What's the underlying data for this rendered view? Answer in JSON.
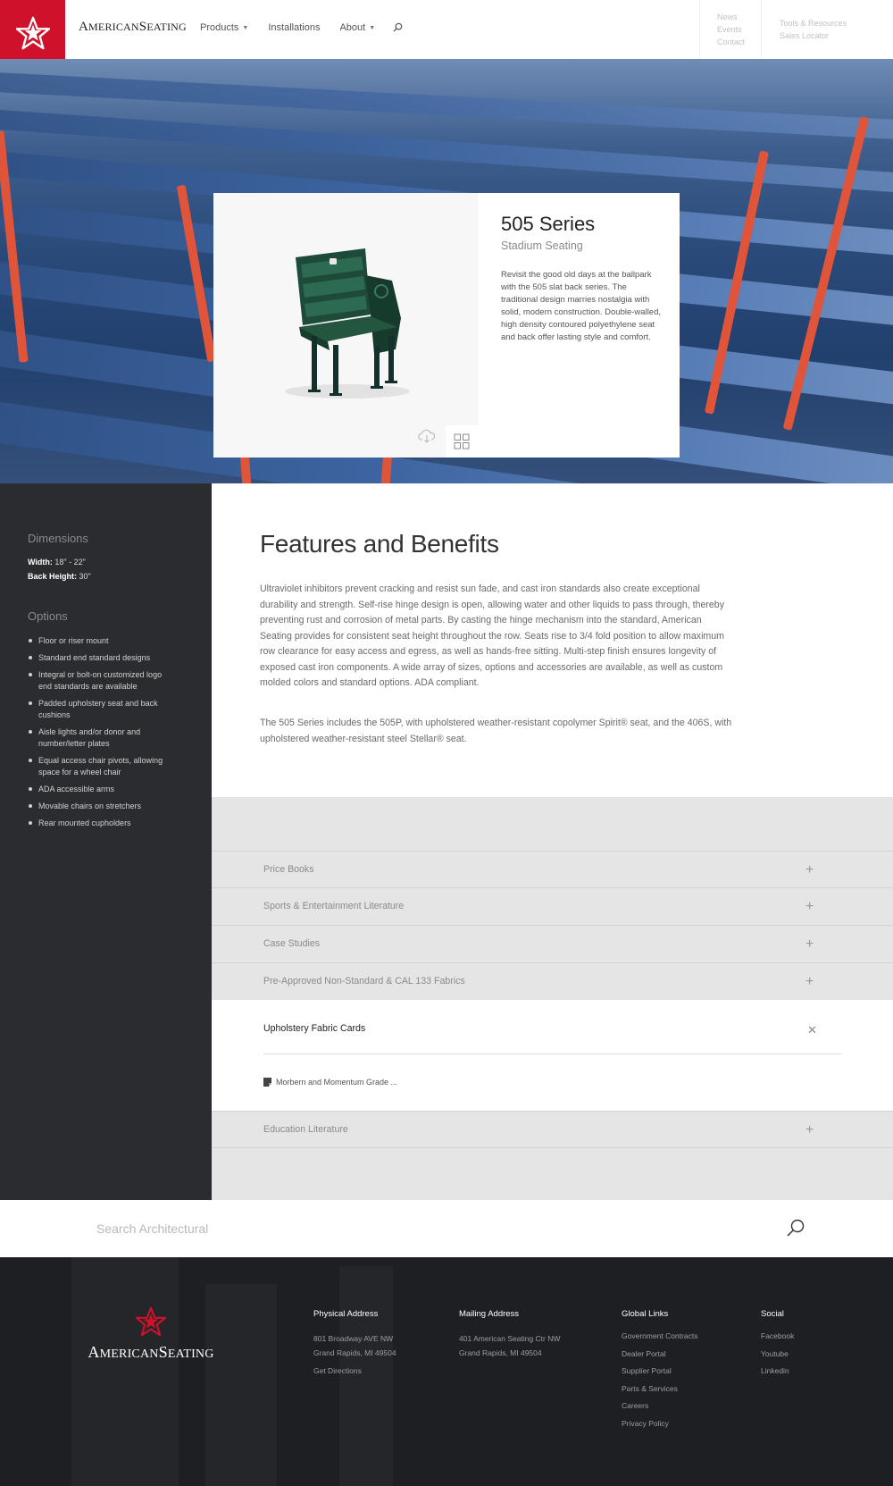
{
  "header": {
    "brand": "AmericanSeating",
    "brand_part1": "A",
    "brand_part2": "MERICAN",
    "brand_part3": "S",
    "brand_part4": "EATING",
    "nav": [
      {
        "label": "Products",
        "has_dropdown": true
      },
      {
        "label": "Installations",
        "has_dropdown": false
      },
      {
        "label": "About",
        "has_dropdown": true
      }
    ],
    "util_links_1": [
      "News",
      "Events",
      "Contact"
    ],
    "util_links_2": [
      "Tools & Resources",
      "Sales Locator"
    ]
  },
  "hero": {
    "title": "505 Series",
    "subtitle": "Stadium Seating",
    "description": "Revisit the good old days at the ballpark with the 505 slat back series. The traditional design marries nostalgia with solid, modern construction. Double-walled, high density contoured polyethylene seat and back offer lasting style and comfort."
  },
  "sidebar": {
    "dimensions_heading": "Dimensions",
    "width_label": "Width:",
    "width_value": " 18\" - 22\"",
    "back_height_label": "Back Height:",
    "back_height_value": " 30\"",
    "options_heading": "Options",
    "options": [
      "Floor or riser mount",
      "Standard end standard designs",
      "Integral or bolt-on customized logo end standards are available",
      "Padded upholstery seat and back cushions",
      "Aisle lights and/or donor and number/letter plates",
      "Equal access chair pivots, allowing space for a wheel chair",
      "ADA accessible arms",
      "Movable chairs on stretchers",
      "Rear mounted cupholders"
    ]
  },
  "features": {
    "heading": "Features and Benefits",
    "paragraph1": "Ultraviolet inhibitors prevent cracking and resist sun fade, and cast iron standards also create exceptional durability and strength. Self-rise hinge design is open, allowing water and other liquids to pass through, thereby preventing rust and corrosion of metal parts. By casting the hinge mechanism into the standard, American Seating provides for consistent seat height throughout the row. Seats rise to 3/4 fold position to allow maximum row clearance for easy access and egress, as well as hands-free sitting. Multi-step finish ensures longevity of exposed cast iron components. A wide array of sizes, options and accessories are available, as well as custom molded colors and standard options. ADA compliant.",
    "paragraph2": "The 505 Series includes the 505P, with upholstered weather-resistant copolymer Spirit® seat, and the 406S, with upholstered weather-resistant steel Stellar® seat."
  },
  "accordion": {
    "items": [
      {
        "label": "Price Books"
      },
      {
        "label": "Sports & Entertainment Literature"
      },
      {
        "label": "Case Studies"
      },
      {
        "label": "Pre-Approved Non-Standard & CAL 133 Fabrics"
      }
    ],
    "open_item": {
      "label": "Upholstery Fabric Cards",
      "file": "Morbern and Momentum Grade ..."
    },
    "last_item": {
      "label": "Education Literature"
    }
  },
  "search": {
    "placeholder": "Search Architectural"
  },
  "footer": {
    "brand_part1": "A",
    "brand_part2": "MERICAN",
    "brand_part3": "S",
    "brand_part4": "EATING",
    "physical": {
      "heading": "Physical Address",
      "line1": "801 Broadway AVE NW",
      "line2": "Grand Rapids, MI 49504",
      "directions": "Get Directions"
    },
    "mailing": {
      "heading": "Mailing Address",
      "line1": "401 American Seating Ctr NW",
      "line2": "Grand Rapids, MI 49504"
    },
    "global": {
      "heading": "Global Links",
      "links": [
        "Government Contracts",
        "Dealer Portal",
        "Supplier Portal",
        "Parts & Services",
        "Careers",
        "Privacy Policy"
      ]
    },
    "social": {
      "heading": "Social",
      "links": [
        "Facebook",
        "Youtube",
        "Linkedin"
      ]
    }
  },
  "colors": {
    "brand_red": "#d0112b",
    "sidebar_bg": "#2b2c2f",
    "footer_bg": "#1e1f22",
    "accordion_bg": "#e5e5e5"
  },
  "icons": {
    "logo": "star-icon",
    "search": "search-icon",
    "download": "cloud-download-icon",
    "grid": "grid-icon",
    "expand": "plus-icon",
    "collapse": "close-icon",
    "file": "document-icon"
  }
}
